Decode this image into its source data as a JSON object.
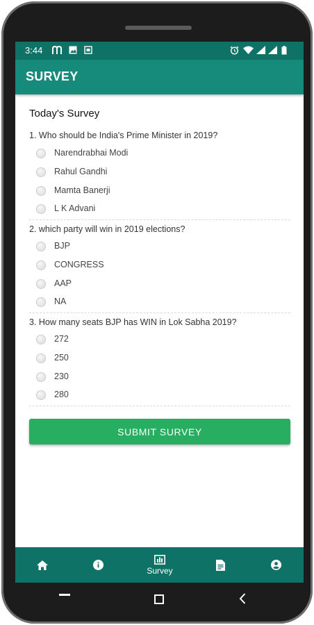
{
  "status_bar": {
    "time": "3:44"
  },
  "app_bar": {
    "title": "SURVEY"
  },
  "survey": {
    "heading": "Today's Survey",
    "questions": [
      {
        "text": "1. Who should be India's Prime Minister in 2019?",
        "options": [
          "Narendrabhai Modi",
          "Rahul Gandhi",
          "Mamta Banerji",
          "L K Advani"
        ]
      },
      {
        "text": "2. which party will win in 2019 elections?",
        "options": [
          "BJP",
          "CONGRESS",
          "AAP",
          "NA"
        ]
      },
      {
        "text": "3. How many seats BJP has WIN in Lok Sabha 2019?",
        "options": [
          "272",
          "250",
          "230",
          "280"
        ]
      }
    ],
    "submit_label": "SUBMIT SURVEY"
  },
  "bottom_nav": {
    "items": [
      {
        "icon": "home-icon",
        "label": ""
      },
      {
        "icon": "info-icon",
        "label": ""
      },
      {
        "icon": "survey-icon",
        "label": "Survey"
      },
      {
        "icon": "document-icon",
        "label": ""
      },
      {
        "icon": "account-icon",
        "label": ""
      }
    ]
  },
  "colors": {
    "status_bar": "#0f7266",
    "app_bar": "#168a7b",
    "bottom_nav": "#0f7266",
    "submit_button": "#27ae60"
  }
}
